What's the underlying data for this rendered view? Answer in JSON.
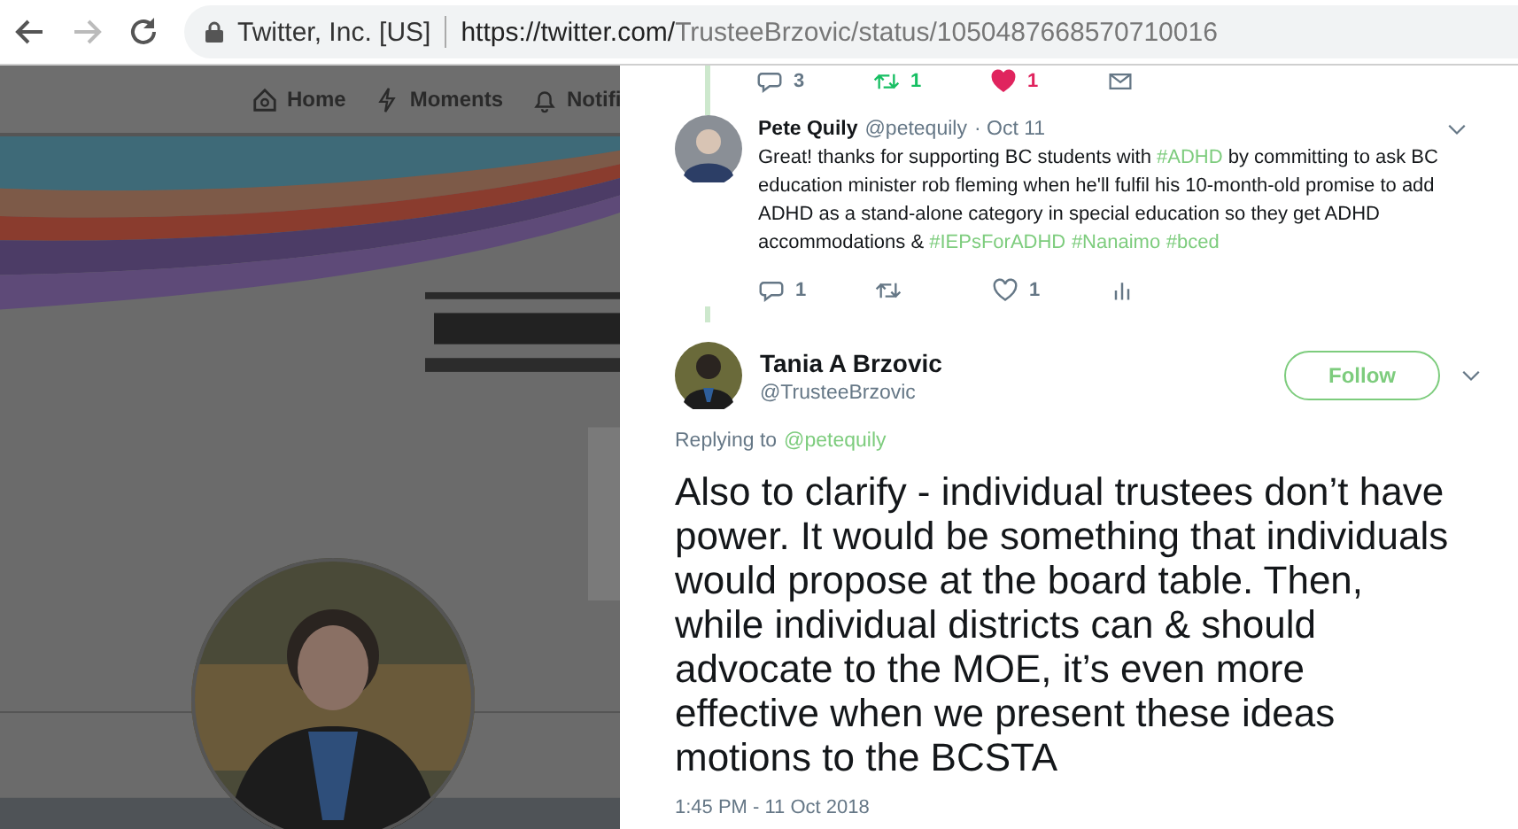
{
  "browser": {
    "site_identity": "Twitter, Inc. [US]",
    "url_domain": "https://twitter.com/",
    "url_path": "TrusteeBrzovic/status/1050487668570710016"
  },
  "background_page": {
    "nav": [
      {
        "kind": "home",
        "label": "Home"
      },
      {
        "kind": "moments",
        "label": "Moments"
      },
      {
        "kind": "notifications",
        "label": "Notifi"
      }
    ]
  },
  "previous_actions": [
    {
      "kind": "reply",
      "count": "3",
      "active": false
    },
    {
      "kind": "retweet",
      "count": "1",
      "active": true
    },
    {
      "kind": "like",
      "count": "1",
      "active": true
    },
    {
      "kind": "message",
      "active": false
    }
  ],
  "reply_tweet": {
    "name": "Pete Quily",
    "handle": "@petequily",
    "date": "· Oct 11",
    "text_parts": [
      {
        "kind": "plain",
        "text": "Great! thanks for supporting BC students with "
      },
      {
        "kind": "hashtag",
        "text": "#ADHD"
      },
      {
        "kind": "plain",
        "text": " by committing to ask BC education minister rob fleming when he'll fulfil his 10-month-old promise to add ADHD as a stand-alone category in special education so they get ADHD accommodations & "
      },
      {
        "kind": "hashtag",
        "text": "#IEPsForADHD"
      },
      {
        "kind": "hashtag",
        "text": "#Nanaimo"
      },
      {
        "kind": "hashtag",
        "text": "#bced"
      }
    ],
    "actions": [
      {
        "kind": "reply",
        "count": "1",
        "active": false
      },
      {
        "kind": "retweet",
        "active": false
      },
      {
        "kind": "like",
        "count": "1",
        "active": false
      },
      {
        "kind": "analytics",
        "active": false
      }
    ]
  },
  "main_tweet": {
    "name": "Tania A Brzovic",
    "handle": "@TrusteeBrzovic",
    "follow_label": "Follow",
    "replying_label": "Replying to",
    "replying_to": "@petequily",
    "text": "Also to clarify - individual trustees don’t have power. It would be something that individuals would propose at the board table. Then, while individual districts can & should advocate to the MOE, it’s even more effective when we present these ideas motions to the BCSTA",
    "timestamp": "1:45 PM - 11 Oct 2018"
  }
}
